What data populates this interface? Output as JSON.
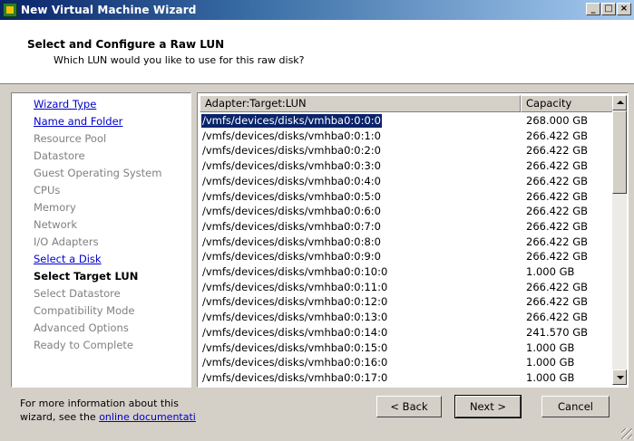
{
  "window": {
    "title": "New Virtual Machine Wizard"
  },
  "header": {
    "title": "Select and Configure a Raw LUN",
    "subtitle": "Which LUN would you like to use for this raw disk?"
  },
  "steps": [
    {
      "label": "Wizard Type",
      "state": "link"
    },
    {
      "label": "Name and Folder",
      "state": "link"
    },
    {
      "label": "Resource Pool",
      "state": "dim"
    },
    {
      "label": "Datastore",
      "state": "dim"
    },
    {
      "label": "Guest Operating System",
      "state": "dim"
    },
    {
      "label": "CPUs",
      "state": "dim"
    },
    {
      "label": "Memory",
      "state": "dim"
    },
    {
      "label": "Network",
      "state": "dim"
    },
    {
      "label": "I/O Adapters",
      "state": "dim"
    },
    {
      "label": "Select a Disk",
      "state": "link"
    },
    {
      "label": "Select Target LUN",
      "state": "current"
    },
    {
      "label": "Select Datastore",
      "state": "dim"
    },
    {
      "label": "Compatibility Mode",
      "state": "dim"
    },
    {
      "label": "Advanced Options",
      "state": "dim"
    },
    {
      "label": "Ready to Complete",
      "state": "dim"
    }
  ],
  "table": {
    "columns": [
      "Adapter:Target:LUN",
      "Capacity"
    ],
    "rows": [
      {
        "path": "/vmfs/devices/disks/vmhba0:0:0:0",
        "capacity": "268.000 GB",
        "selected": true
      },
      {
        "path": "/vmfs/devices/disks/vmhba0:0:1:0",
        "capacity": "266.422 GB"
      },
      {
        "path": "/vmfs/devices/disks/vmhba0:0:2:0",
        "capacity": "266.422 GB"
      },
      {
        "path": "/vmfs/devices/disks/vmhba0:0:3:0",
        "capacity": "266.422 GB"
      },
      {
        "path": "/vmfs/devices/disks/vmhba0:0:4:0",
        "capacity": "266.422 GB"
      },
      {
        "path": "/vmfs/devices/disks/vmhba0:0:5:0",
        "capacity": "266.422 GB"
      },
      {
        "path": "/vmfs/devices/disks/vmhba0:0:6:0",
        "capacity": "266.422 GB"
      },
      {
        "path": "/vmfs/devices/disks/vmhba0:0:7:0",
        "capacity": "266.422 GB"
      },
      {
        "path": "/vmfs/devices/disks/vmhba0:0:8:0",
        "capacity": "266.422 GB"
      },
      {
        "path": "/vmfs/devices/disks/vmhba0:0:9:0",
        "capacity": "266.422 GB"
      },
      {
        "path": "/vmfs/devices/disks/vmhba0:0:10:0",
        "capacity": "1.000 GB"
      },
      {
        "path": "/vmfs/devices/disks/vmhba0:0:11:0",
        "capacity": "266.422 GB"
      },
      {
        "path": "/vmfs/devices/disks/vmhba0:0:12:0",
        "capacity": "266.422 GB"
      },
      {
        "path": "/vmfs/devices/disks/vmhba0:0:13:0",
        "capacity": "266.422 GB"
      },
      {
        "path": "/vmfs/devices/disks/vmhba0:0:14:0",
        "capacity": "241.570 GB"
      },
      {
        "path": "/vmfs/devices/disks/vmhba0:0:15:0",
        "capacity": "1.000 GB"
      },
      {
        "path": "/vmfs/devices/disks/vmhba0:0:16:0",
        "capacity": "1.000 GB"
      },
      {
        "path": "/vmfs/devices/disks/vmhba0:0:17:0",
        "capacity": "1.000 GB"
      }
    ]
  },
  "footer": {
    "info_line1": "For more information about this",
    "info_line2": "wizard, see the ",
    "info_link": "online documentati"
  },
  "buttons": {
    "back": "< Back",
    "next": "Next >",
    "cancel": "Cancel"
  },
  "icons": {
    "app": "vm-wizard-icon",
    "minimize": "minimize-icon",
    "maximize": "maximize-icon",
    "close": "close-icon"
  }
}
